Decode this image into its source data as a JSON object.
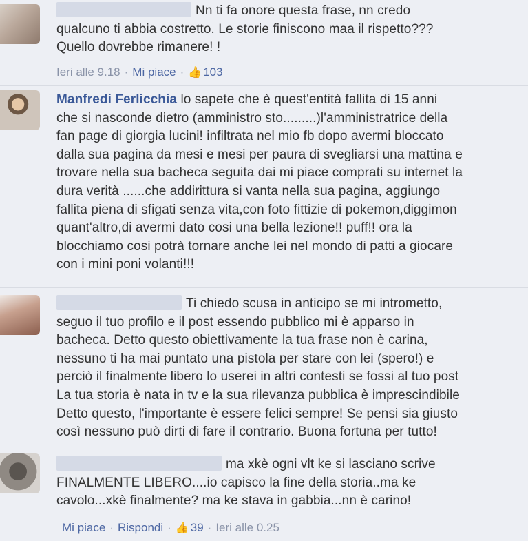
{
  "comments": [
    {
      "author": "",
      "lines": [
        "Nn ti fa onore questa frase, nn credo",
        "qualcuno ti abbia costretto. Le storie finiscono maa il rispetto???",
        "Quello dovrebbe rimanere! !"
      ],
      "time": "Ieri alle 9.18",
      "like_label": "Mi piace",
      "like_count": "103"
    },
    {
      "author": "Manfredi Ferlicchia",
      "lines": [
        "lo sapete che è quest'entità fallita di 15 anni",
        "che si nasconde dietro (amministro sto.........)l'amministratrice della",
        "fan page di giorgia lucini! infiltrata nel mio fb dopo avermi bloccato",
        "dalla sua pagina da mesi e mesi per paura di svegliarsi una mattina e",
        "trovare nella sua bacheca seguita dai mi piace comprati su internet la",
        "dura verità ......che addirittura si vanta nella sua pagina, aggiungo",
        "fallita piena di sfigati senza vita,con foto fittizie di pokemon,diggimon",
        "quant'altro,di avermi dato cosi una bella lezione!! puff!! ora la",
        "blocchiamo cosi potrà tornare anche lei nel mondo di patti a giocare",
        "con i mini poni volanti!!!"
      ]
    },
    {
      "author": "",
      "lines": [
        "Ti chiedo scusa in anticipo se mi intrometto,",
        "seguo il tuo profilo e il post essendo pubblico mi è apparso in",
        "bacheca. Detto questo obiettivamente la tua frase non è carina,",
        "nessuno ti ha mai puntato una pistola per stare con lei (spero!) e",
        "perciò il finalmente libero lo userei in altri contesti se fossi al tuo post",
        "La tua storia è nata in tv e la sua rilevanza pubblica è imprescindibile",
        "Detto questo, l'importante è essere felici sempre! Se pensi sia giusto",
        "così nessuno può dirti di fare il contrario. Buona fortuna per tutto!"
      ]
    },
    {
      "author": "",
      "lines": [
        "ma xkè ogni vlt ke si lasciano scrive",
        "FINALMENTE LIBERO....io capisco la fine della storia..ma ke",
        "cavolo...xkè finalmente? ma ke stava in gabbia...nn è carino!"
      ],
      "like_label": "Mi piace",
      "reply_label": "Rispondi",
      "like_count": "39",
      "time": "Ieri alle 0.25"
    }
  ]
}
